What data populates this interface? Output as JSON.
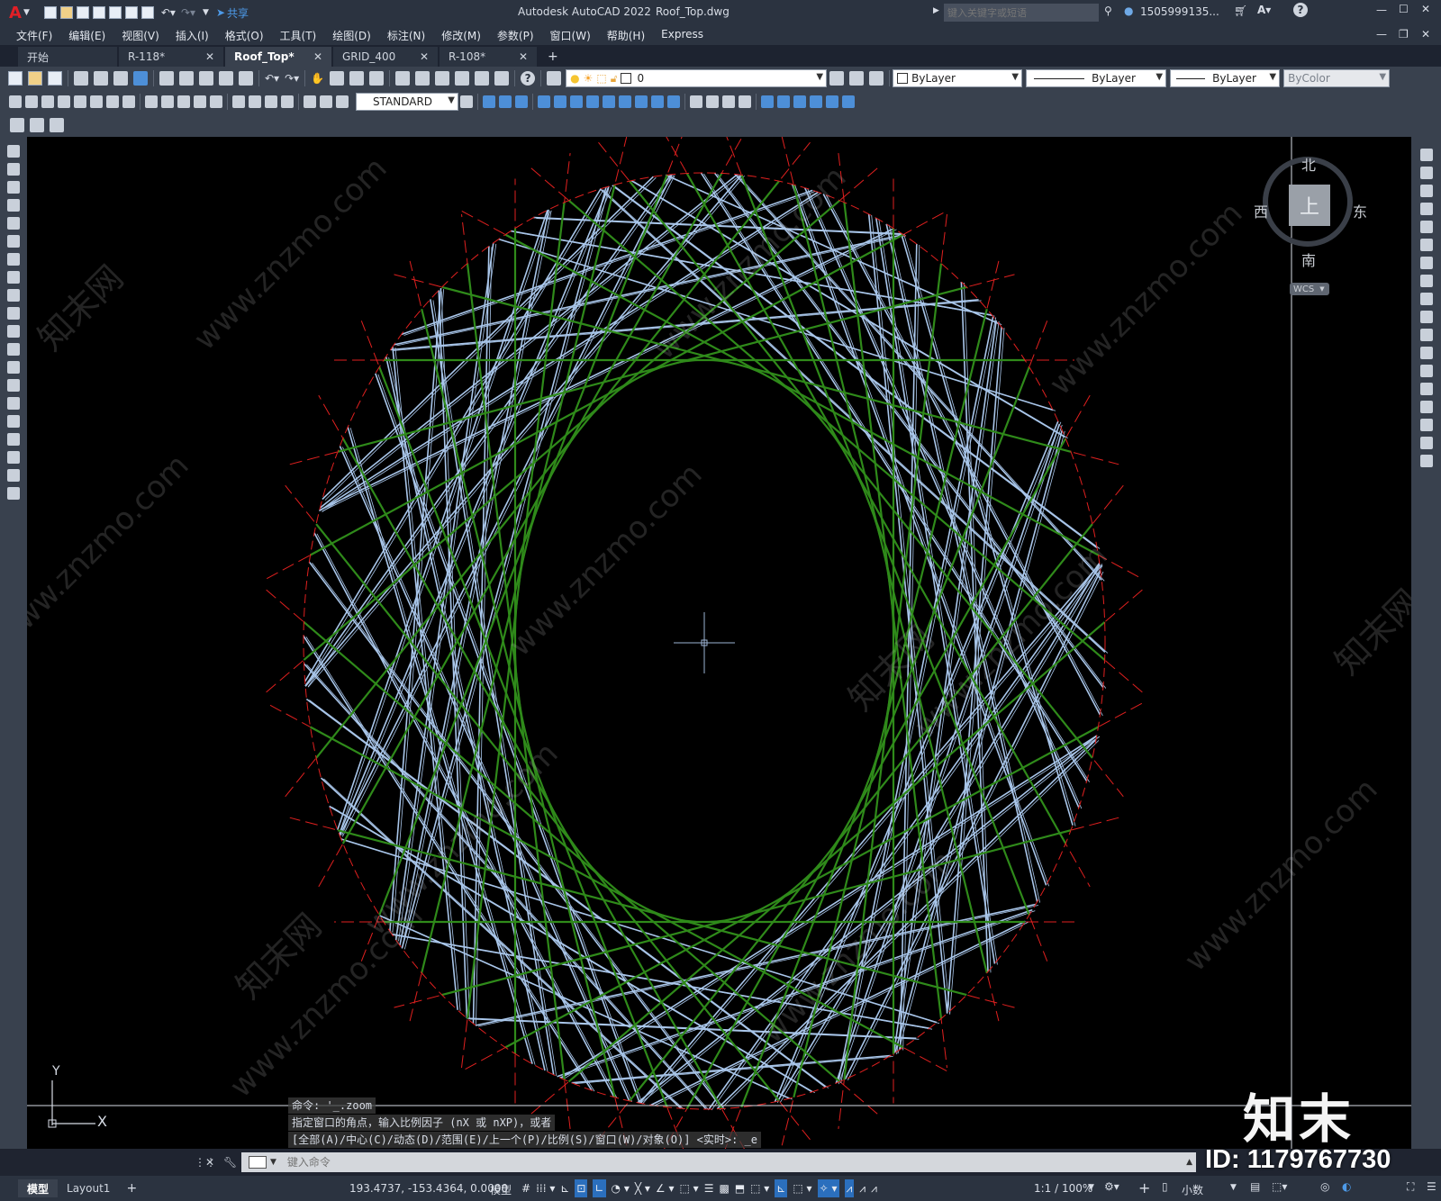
{
  "app": {
    "logo": "A",
    "title": "Autodesk AutoCAD 2022",
    "filename": "Roof_Top.dwg",
    "share_label": "共享",
    "search_placeholder": "键入关键字或短语",
    "user": "1505999135...",
    "window_controls": [
      "minimize-icon",
      "maximize-icon",
      "close-icon"
    ]
  },
  "menu": [
    "文件(F)",
    "编辑(E)",
    "视图(V)",
    "插入(I)",
    "格式(O)",
    "工具(T)",
    "绘图(D)",
    "标注(N)",
    "修改(M)",
    "参数(P)",
    "窗口(W)",
    "帮助(H)",
    "Express"
  ],
  "tabs": [
    {
      "label": "开始",
      "closable": false,
      "active": false
    },
    {
      "label": "R-118*",
      "closable": true,
      "active": false
    },
    {
      "label": "Roof_Top*",
      "closable": true,
      "active": true
    },
    {
      "label": "GRID_400",
      "closable": true,
      "active": false
    },
    {
      "label": "R-108*",
      "closable": true,
      "active": false
    }
  ],
  "layer": {
    "value": "0"
  },
  "properties": {
    "color": "ByLayer",
    "linetype": "ByLayer",
    "lineweight": "ByLayer",
    "plotstyle": "ByColor"
  },
  "dimstyle": {
    "value": "STANDARD"
  },
  "viewcube": {
    "north": "北",
    "south": "南",
    "east": "东",
    "west": "西",
    "top": "上",
    "wcs": "WCS"
  },
  "ucs": {
    "y": "Y",
    "x": "X"
  },
  "command_history": [
    "命令: '_.zoom",
    "指定窗口的角点，输入比例因子 (nX 或 nXP)，或者",
    "[全部(A)/中心(C)/动态(D)/范围(E)/上一个(P)/比例(S)/窗口(W)/对象(O)] <实时>: _e"
  ],
  "command_input": {
    "placeholder": "键入命令"
  },
  "layout_tabs": [
    "模型",
    "Layout1"
  ],
  "status": {
    "coords": "193.4737, -153.4364, 0.0000",
    "space": "模型",
    "scale": "1:1 / 100%",
    "units": "小数"
  },
  "watermark": {
    "brand": "知末",
    "id": "ID: 1179767730",
    "site": "www.znzmo.com",
    "site_cn": "知末网"
  },
  "colors": {
    "viewport_bg": "#000000",
    "beam_blue": "#a9c6ea",
    "beam_green": "#2f8a1a",
    "construction_red": "#e0201f",
    "ui_dark": "#2b3340",
    "ui_panel": "#39414e"
  }
}
